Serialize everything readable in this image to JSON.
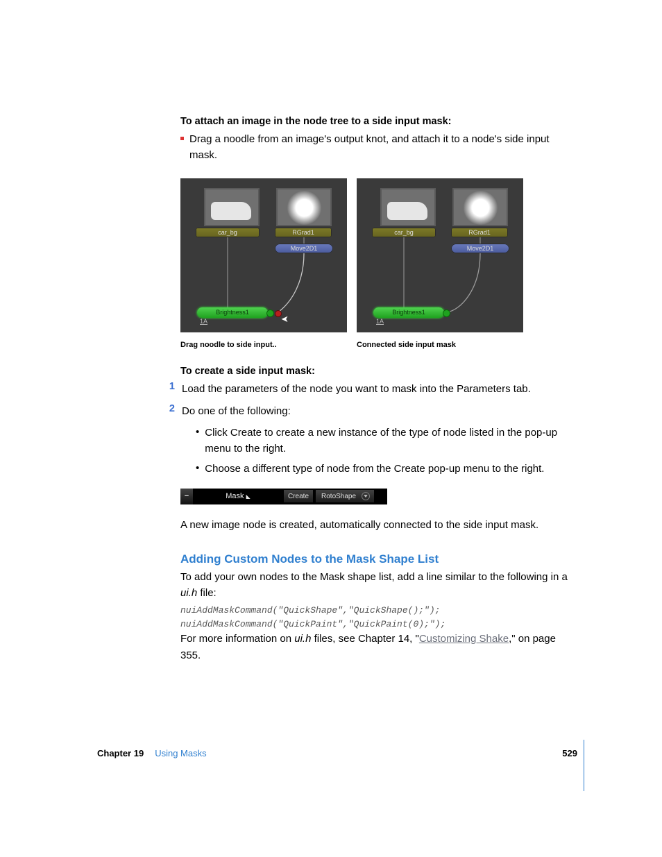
{
  "heading1": "To attach an image in the node tree to a side input mask:",
  "step1": "Drag a noodle from an image's output knot, and attach it to a node's side input mask.",
  "figures": {
    "nodes": {
      "car_bg": "car_bg",
      "rgrad": "RGrad1",
      "move2d": "Move2D1",
      "brightness": "Brightness1",
      "one_a": "1A"
    },
    "caption_left": "Drag noodle to side input..",
    "caption_right": "Connected side input mask"
  },
  "heading2": "To create a side input mask:",
  "ol": {
    "n1": "1",
    "t1": "Load the parameters of the node you want to mask into the Parameters tab.",
    "n2": "2",
    "t2": "Do one of the following:"
  },
  "sub": {
    "a": "Click Create to create a new instance of the type of node listed in the pop-up menu to the right.",
    "b": "Choose a different type of node from the Create pop-up menu to the right."
  },
  "maskbar": {
    "collapse": "−",
    "label": "Mask",
    "create_btn": "Create",
    "dropdown": "RotoShape"
  },
  "afterbar": "A new image node is created, automatically connected to the side input mask.",
  "blue_heading": "Adding Custom Nodes to the Mask Shape List",
  "blue_p1a": "To add your own nodes to the Mask shape list, add a line similar to the following in a ",
  "blue_p1b": "ui.h",
  "blue_p1c": " file:",
  "code": "nuiAddMaskCommand(\"QuickShape\",\"QuickShape();\");\nnuiAddMaskCommand(\"QuickPaint\",\"QuickPaint(0);\");",
  "blue_p2a": "For more information on ",
  "blue_p2b": "ui.h",
  "blue_p2c": " files, see Chapter 14, \"",
  "blue_link": "Customizing Shake",
  "blue_p2d": ",\" on page 355.",
  "footer": {
    "chapter": "Chapter 19",
    "title": "Using Masks",
    "page": "529"
  }
}
